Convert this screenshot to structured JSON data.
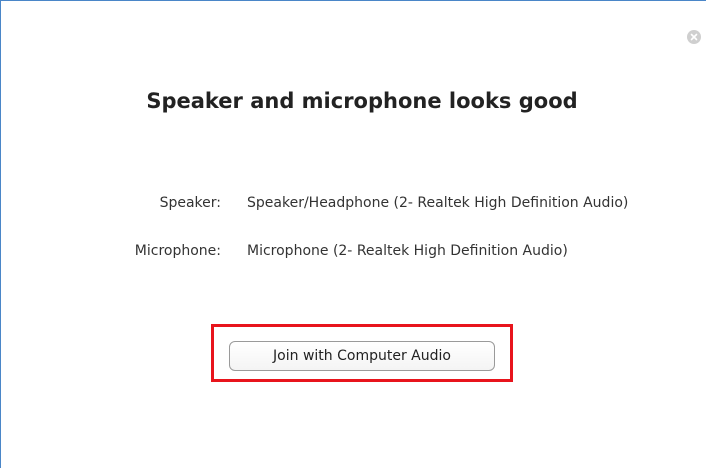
{
  "dialog": {
    "title": "Speaker and microphone looks good",
    "close_icon": "close-icon",
    "speaker": {
      "label": "Speaker:",
      "value": "Speaker/Headphone (2- Realtek High Definition Audio)"
    },
    "microphone": {
      "label": "Microphone:",
      "value": "Microphone (2- Realtek High Definition Audio)"
    },
    "join_button_label": "Join with Computer Audio"
  },
  "colors": {
    "window_border": "#4a86c8",
    "highlight": "#e8141c",
    "close_icon_bg": "#cfcfcf"
  }
}
